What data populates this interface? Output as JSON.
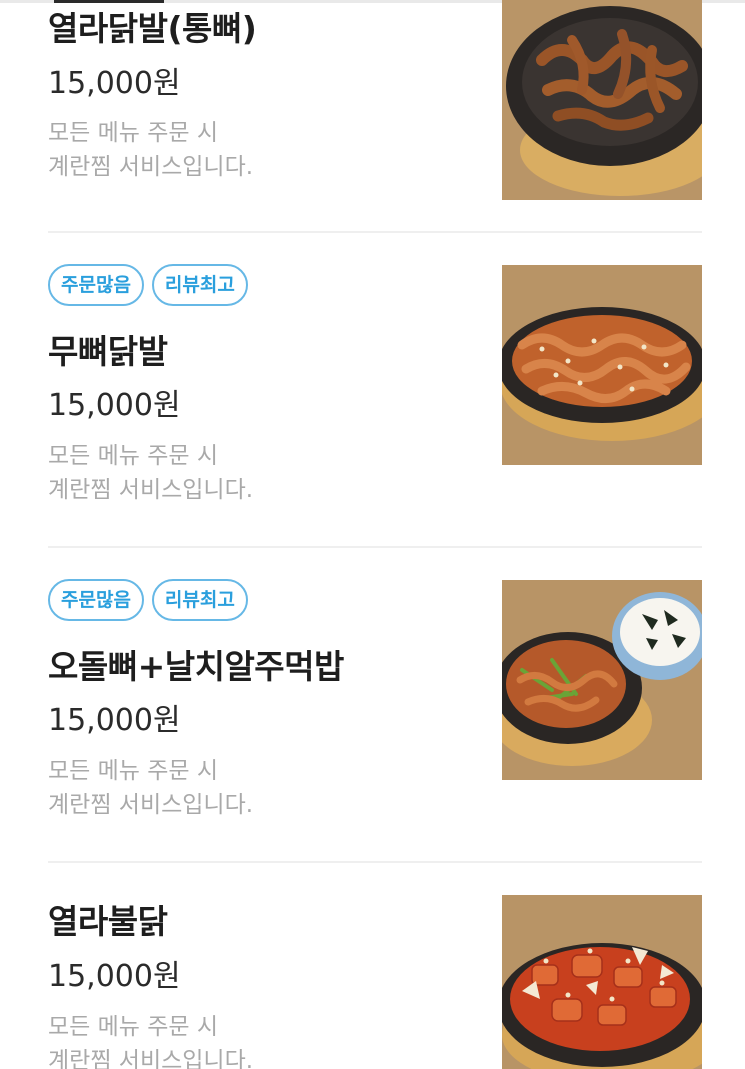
{
  "menu": {
    "items": [
      {
        "name": "열라닭발(통뼈)",
        "price": "15,000원",
        "desc_line1": "모든 메뉴 주문 시",
        "desc_line2": "계란찜 서비스입니다.",
        "badges": [],
        "photo_icon": "food-photo-icon"
      },
      {
        "name": "무뼈닭발",
        "price": "15,000원",
        "desc_line1": "모든 메뉴 주문 시",
        "desc_line2": "계란찜 서비스입니다.",
        "badges": [
          "주문많음",
          "리뷰최고"
        ],
        "photo_icon": "food-photo-icon"
      },
      {
        "name": "오돌뼈+날치알주먹밥",
        "price": "15,000원",
        "desc_line1": "모든 메뉴 주문 시",
        "desc_line2": "계란찜 서비스입니다.",
        "badges": [
          "주문많음",
          "리뷰최고"
        ],
        "photo_icon": "food-photo-icon"
      },
      {
        "name": "열라불닭",
        "price": "15,000원",
        "desc_line1": "모든 메뉴 주문 시",
        "desc_line2": "계란찜 서비스입니다.",
        "badges": [],
        "photo_icon": "food-photo-icon"
      }
    ]
  },
  "colors": {
    "badge_border": "#66b8e6",
    "badge_text": "#2a9fdd",
    "desc_text": "#a9a9a9",
    "divider": "#efefef"
  }
}
